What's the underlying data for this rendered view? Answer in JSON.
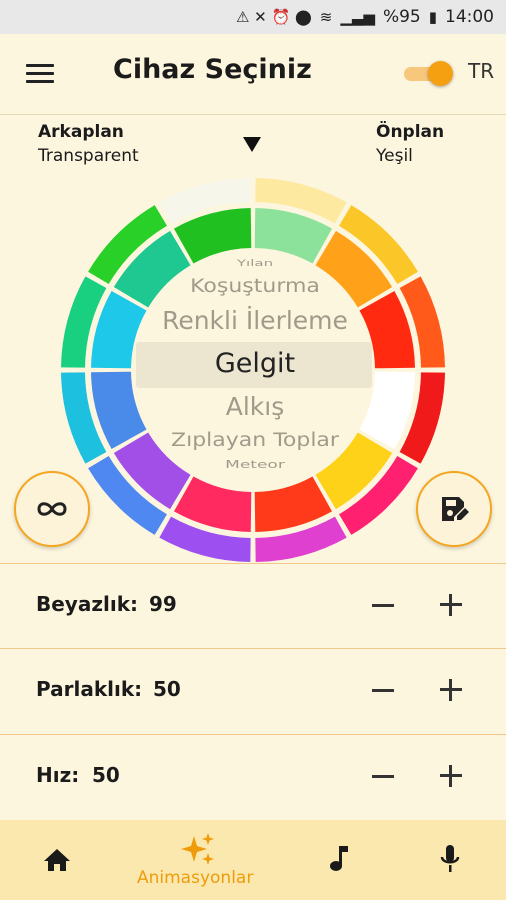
{
  "status_bar": {
    "battery": "%95",
    "time": "14:00"
  },
  "header": {
    "title": "Cihaz Seçiniz",
    "language": "TR",
    "toggle_on": true
  },
  "background": {
    "label": "Arkaplan",
    "value": "Transparent"
  },
  "foreground": {
    "label": "Önplan",
    "value": "Yeşil"
  },
  "animations": {
    "items": [
      {
        "label": "Yılan"
      },
      {
        "label": "Koşuşturma"
      },
      {
        "label": "Renkli İlerleme"
      },
      {
        "label": "Gelgit",
        "selected": true
      },
      {
        "label": "Alkış"
      },
      {
        "label": "Zıplayan Toplar"
      },
      {
        "label": "Meteor"
      }
    ]
  },
  "fabs": {
    "left_icon": "infinity-icon",
    "right_icon": "save-edit-icon"
  },
  "settings": [
    {
      "label": "Beyazlık:",
      "value": "99"
    },
    {
      "label": "Parlaklık:",
      "value": "50"
    },
    {
      "label": "Hız:",
      "value": "50"
    }
  ],
  "bottom_nav": [
    {
      "icon": "home-icon",
      "label": ""
    },
    {
      "icon": "sparkles-icon",
      "label": "Animasyonlar",
      "active": true
    },
    {
      "icon": "music-note-icon",
      "label": ""
    },
    {
      "icon": "microphone-icon",
      "label": ""
    }
  ],
  "colors": {
    "accent": "#f5a010",
    "background": "#fdf6df",
    "nav_bg": "#fbe8ae",
    "divider": "#f1c88a"
  }
}
